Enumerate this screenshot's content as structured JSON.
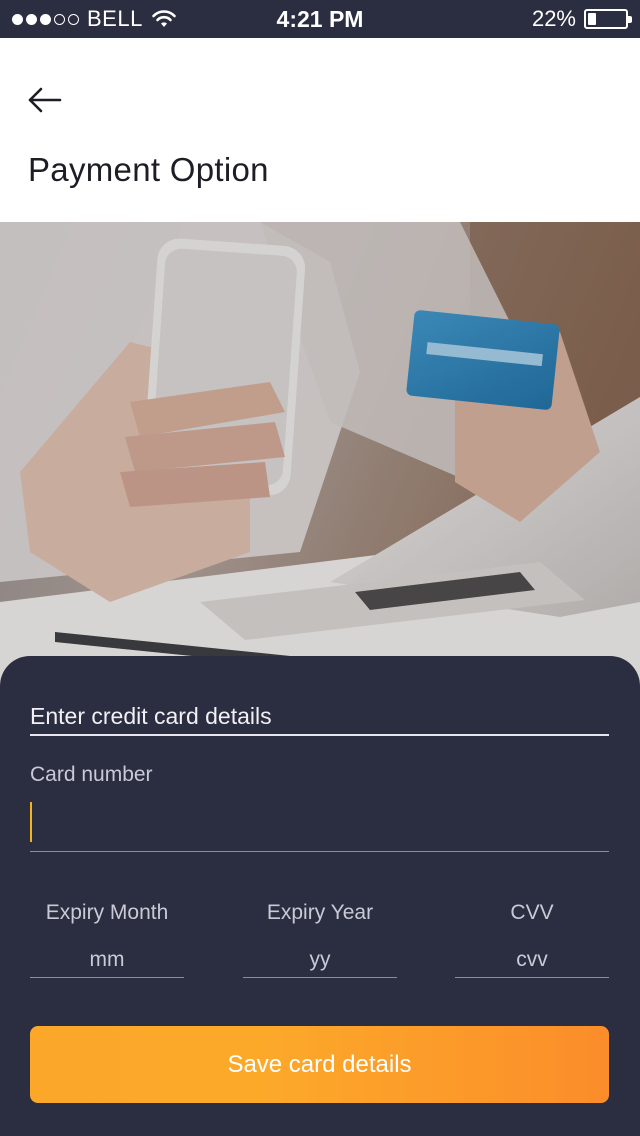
{
  "status_bar": {
    "carrier": "BELL",
    "signal_bars_filled": 3,
    "signal_bars_total": 5,
    "time": "4:21 PM",
    "battery_percent_label": "22%",
    "battery_level": 0.22
  },
  "header": {
    "back_icon": "arrow-left-icon",
    "title": "Payment Option"
  },
  "hero": {
    "image": "hands-holding-phone-and-credit-card-photo"
  },
  "form": {
    "section_title": "Enter credit card details",
    "card_number": {
      "label": "Card number",
      "value": ""
    },
    "expiry_month": {
      "label": "Expiry Month",
      "placeholder": "mm"
    },
    "expiry_year": {
      "label": "Expiry Year",
      "placeholder": "yy"
    },
    "cvv": {
      "label": "CVV",
      "placeholder": "cvv"
    },
    "save_button": "Save card details"
  },
  "colors": {
    "status_bar_bg": "#2b2d40",
    "panel_bg": "#2b2d40",
    "accent_gradient_start": "#fca92a",
    "accent_gradient_end": "#fb8d2a",
    "caret": "#f4b21c"
  }
}
